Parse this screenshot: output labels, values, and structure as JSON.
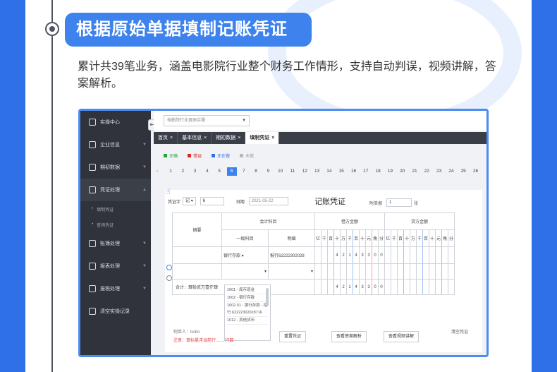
{
  "heading": "根据原始单据填制记账凭证",
  "intro": "累计共39笔业务，涵盖电影院行业整个财务工作情形，支持自动判误，视频讲解，答案解析。",
  "app": {
    "sidebar": [
      {
        "label": "实操中心",
        "icon": "monitor-icon"
      },
      {
        "label": "企业信息",
        "icon": "building-icon"
      },
      {
        "label": "期初数据",
        "icon": "bar-chart-icon"
      },
      {
        "label": "凭证处理",
        "icon": "document-icon",
        "active": true
      },
      {
        "label": "账簿处理",
        "icon": "book-icon"
      },
      {
        "label": "报表处理",
        "icon": "line-chart-icon"
      },
      {
        "label": "报税处理",
        "icon": "tax-icon"
      },
      {
        "label": "清空实操记录",
        "icon": "brush-icon"
      }
    ],
    "sidebar_sub": [
      "填制凭证",
      "查询凭证"
    ],
    "company_select": "电影院行业真账实操",
    "tabs": [
      {
        "label": "首页"
      },
      {
        "label": "基本信息"
      },
      {
        "label": "期初数据"
      },
      {
        "label": "填制凭证",
        "active": true
      }
    ],
    "legend": [
      {
        "label": "正确",
        "color": "#23a639"
      },
      {
        "label": "错误",
        "color": "#e02424"
      },
      {
        "label": "正在做",
        "color": "#2f6fe8"
      },
      {
        "label": "未做",
        "color": "#b4b7bd"
      }
    ],
    "pages": [
      "1",
      "2",
      "3",
      "4",
      "5",
      "6",
      "7",
      "8",
      "9",
      "10",
      "11",
      "12",
      "13",
      "14",
      "15",
      "16",
      "17",
      "18",
      "19",
      "20",
      "21",
      "22",
      "23",
      "24",
      "25",
      "26"
    ],
    "active_page": "6",
    "voucher": {
      "type_label": "凭证字",
      "type_value": "记",
      "number": "6",
      "date_label": "日期",
      "date_value": "2021-05-22",
      "title": "记账凭证",
      "attach_label": "附单据",
      "attach_value": "1",
      "attach_unit": "张",
      "col_summary": "摘要",
      "col_account": "会计科目",
      "col_first": "一级科目",
      "col_detail": "明细",
      "col_debit": "借方金额",
      "col_credit": "贷方金额",
      "digit_headers": [
        "亿",
        "千",
        "百",
        "十",
        "万",
        "千",
        "百",
        "十",
        "元",
        "角",
        "分"
      ],
      "row1_first": "银行存款",
      "row1_detail": "报行62222302028",
      "debit_digits": [
        "",
        "",
        "",
        "",
        "4",
        "2",
        "1",
        "4",
        "3",
        "3",
        "0",
        "0"
      ],
      "total_label": "合计：肆拾贰万壹仟肆",
      "dropdown_items": [
        "1001 - 库存现金",
        "1002 - 银行存款",
        "1002.01 - 银行存款 - 招行 62222302028716",
        "1012 - 其他货币"
      ],
      "maker": "制单人：bobo",
      "clear": "清空凭证",
      "note": "注意：鼠标悬浮当前行 ...... 行数",
      "buttons": [
        "重置凭证",
        "查看答案解析",
        "查看视频讲解"
      ]
    }
  }
}
